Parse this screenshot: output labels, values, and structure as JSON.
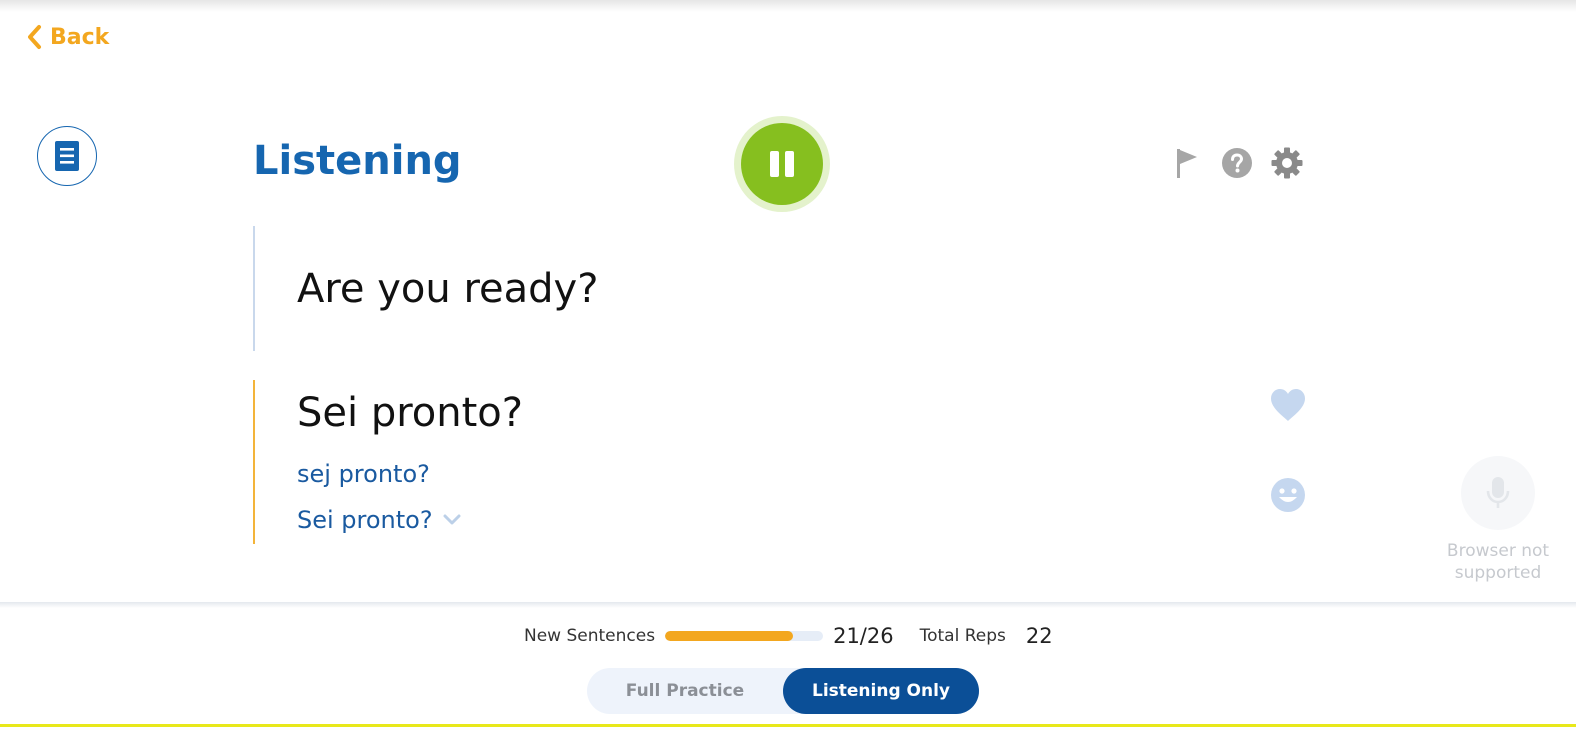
{
  "nav": {
    "back_label": "Back"
  },
  "header": {
    "title": "Listening",
    "playback_state": "pause-icon"
  },
  "toolbar": {
    "icons": [
      "flag-icon",
      "help-icon",
      "gear-icon"
    ]
  },
  "prompt": {
    "text": "Are you ready?"
  },
  "answer": {
    "text": "Sei pronto?",
    "phonetic": "sej pronto?",
    "transliteration": "Sei pronto?"
  },
  "microphone": {
    "status": "Browser not supported"
  },
  "progress": {
    "label": "New Sentences",
    "done": 21,
    "total": 26,
    "count_text": "21/26",
    "reps_label": "Total Reps",
    "reps_value": "22"
  },
  "modes": {
    "options": [
      "Full Practice",
      "Listening Only"
    ],
    "active": "Listening Only"
  },
  "colors": {
    "accent_orange": "#f3a71f",
    "brand_blue": "#1666b0",
    "play_green": "#86bf1f",
    "active_mode": "#0b4f97",
    "bottom_bar": "#e8e81a"
  }
}
